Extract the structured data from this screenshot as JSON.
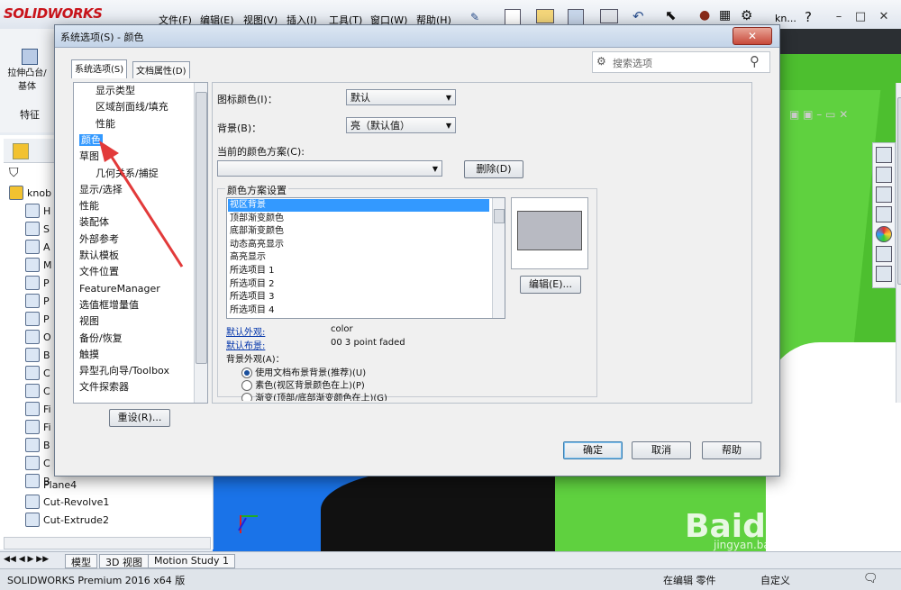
{
  "app": {
    "logo": "SOLIDWORKS",
    "menus": [
      "文件(F)",
      "编辑(E)",
      "视图(V)",
      "插入(I)",
      "工具(T)",
      "窗口(W)",
      "帮助(H)"
    ],
    "user": "kn...",
    "help": "?"
  },
  "command_manager": {
    "extrude_label": "拉伸凸台/基体",
    "features_tab": "特征"
  },
  "feature_tree": {
    "root": "knob",
    "items": [
      "H",
      "S",
      "A",
      "M",
      "P",
      "P",
      "P",
      "O",
      "B",
      "C",
      "C",
      "Fi",
      "Fi",
      "B",
      "C",
      "B",
      "Plane4",
      "Cut-Revolve1",
      "Cut-Extrude2"
    ]
  },
  "bottom_tabs": [
    "模型",
    "3D 视图",
    "Motion Study 1"
  ],
  "status_bar": {
    "left": "SOLIDWORKS Premium 2016 x64 版",
    "mode": "在编辑 零件",
    "custom": "自定义"
  },
  "watermark": {
    "main": "Baidu 经验",
    "sub": "jingyan.baidu.com"
  },
  "dialog": {
    "title": "系统选项(S) - 颜色",
    "close": "✕",
    "tabs": [
      "系统选项(S)",
      "文档属性(D)"
    ],
    "search_placeholder": "搜索选项",
    "nav_items": [
      {
        "label": "显示类型",
        "sub": true
      },
      {
        "label": "区域剖面线/填充",
        "sub": true
      },
      {
        "label": "性能",
        "sub": true
      },
      {
        "label": "颜色",
        "sub": false,
        "selected": true
      },
      {
        "label": "草图",
        "sub": false
      },
      {
        "label": "几何关系/捕捉",
        "sub": true
      },
      {
        "label": "显示/选择",
        "sub": false
      },
      {
        "label": "性能",
        "sub": false
      },
      {
        "label": "装配体",
        "sub": false
      },
      {
        "label": "外部参考",
        "sub": false
      },
      {
        "label": "默认模板",
        "sub": false
      },
      {
        "label": "文件位置",
        "sub": false
      },
      {
        "label": "FeatureManager",
        "sub": false
      },
      {
        "label": "选值框增量值",
        "sub": false
      },
      {
        "label": "视图",
        "sub": false
      },
      {
        "label": "备份/恢复",
        "sub": false
      },
      {
        "label": "触摸",
        "sub": false
      },
      {
        "label": "异型孔向导/Toolbox",
        "sub": false
      },
      {
        "label": "文件探索器",
        "sub": false
      }
    ],
    "reset_button": "重设(R)...",
    "icon_color_label": "图标颜色(I)：",
    "icon_color_value": "默认",
    "background_label": "背景(B)：",
    "background_value": "亮（默认值）",
    "current_scheme_label": "当前的颜色方案(C):",
    "current_scheme_value": "",
    "delete_button": "删除(D)",
    "scheme_settings_title": "颜色方案设置",
    "scheme_items": [
      "视区背景",
      "顶部渐变颜色",
      "底部渐变颜色",
      "动态高亮显示",
      "高亮显示",
      "所选项目 1",
      "所选项目 2",
      "所选项目 3",
      "所选项目 4"
    ],
    "edit_button": "编辑(E)...",
    "default_appearance_link": "默认外观:",
    "default_appearance_value": "color",
    "default_scene_link": "默认布景:",
    "default_scene_value": "00 3 point faded",
    "bg_appearance_label": "背景外观(A)：",
    "radio_options": [
      {
        "label": "使用文档布景背景(推荐)(U)",
        "checked": true
      },
      {
        "label": "素色(视区背景颜色在上)(P)",
        "checked": false
      },
      {
        "label": "渐变(顶部/底部渐变颜色在上)(G)",
        "checked": false
      }
    ],
    "ok_button": "确定",
    "cancel_button": "取消",
    "help_button": "帮助"
  },
  "colors": {
    "selection": "#3399ff",
    "annotation_arrow": "#e23a3a",
    "model_green": "#5fd13f",
    "model_blue": "#1a73e8"
  }
}
